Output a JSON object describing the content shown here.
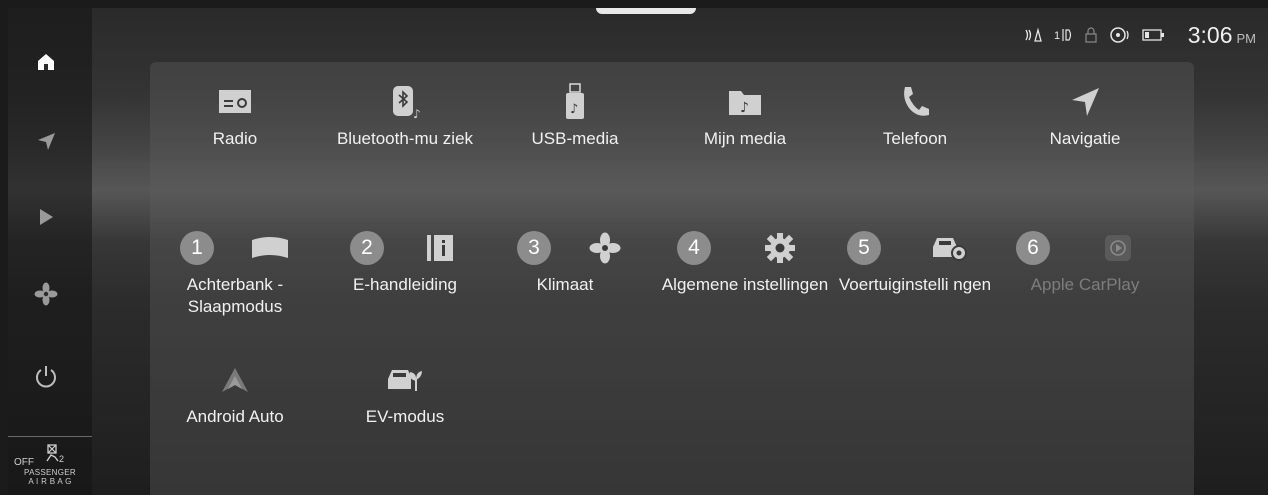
{
  "status": {
    "time": "3:06",
    "ampm": "PM",
    "icons": [
      "passenger-sensor-icon",
      "airbag-seat-icon",
      "lock-icon",
      "steering-heat-icon",
      "battery-icon"
    ]
  },
  "sidebar": {
    "items": [
      {
        "name": "home",
        "icon": "home-icon"
      },
      {
        "name": "navigation",
        "icon": "navigation-icon"
      },
      {
        "name": "media",
        "icon": "play-icon"
      },
      {
        "name": "climate",
        "icon": "fan-icon"
      },
      {
        "name": "power",
        "icon": "power-icon"
      }
    ],
    "airbag": {
      "off": "OFF",
      "line1": "PASSENGER",
      "line2": "A I R B A G"
    }
  },
  "apps": {
    "radio": "Radio",
    "bluetooth": "Bluetooth-mu ziek",
    "usb": "USB-media",
    "mijn_media": "Mijn media",
    "telefoon": "Telefoon",
    "navigatie": "Navigatie",
    "achterbank": "Achterbank - Slaapmodus",
    "handleiding": "E-handleiding",
    "klimaat": "Klimaat",
    "algemene": "Algemene instellingen",
    "voertuig": "Voertuiginstelli ngen",
    "carplay": "Apple CarPlay",
    "android": "Android Auto",
    "ev": "EV-modus"
  },
  "numbers": [
    "1",
    "2",
    "3",
    "4",
    "5",
    "6"
  ]
}
